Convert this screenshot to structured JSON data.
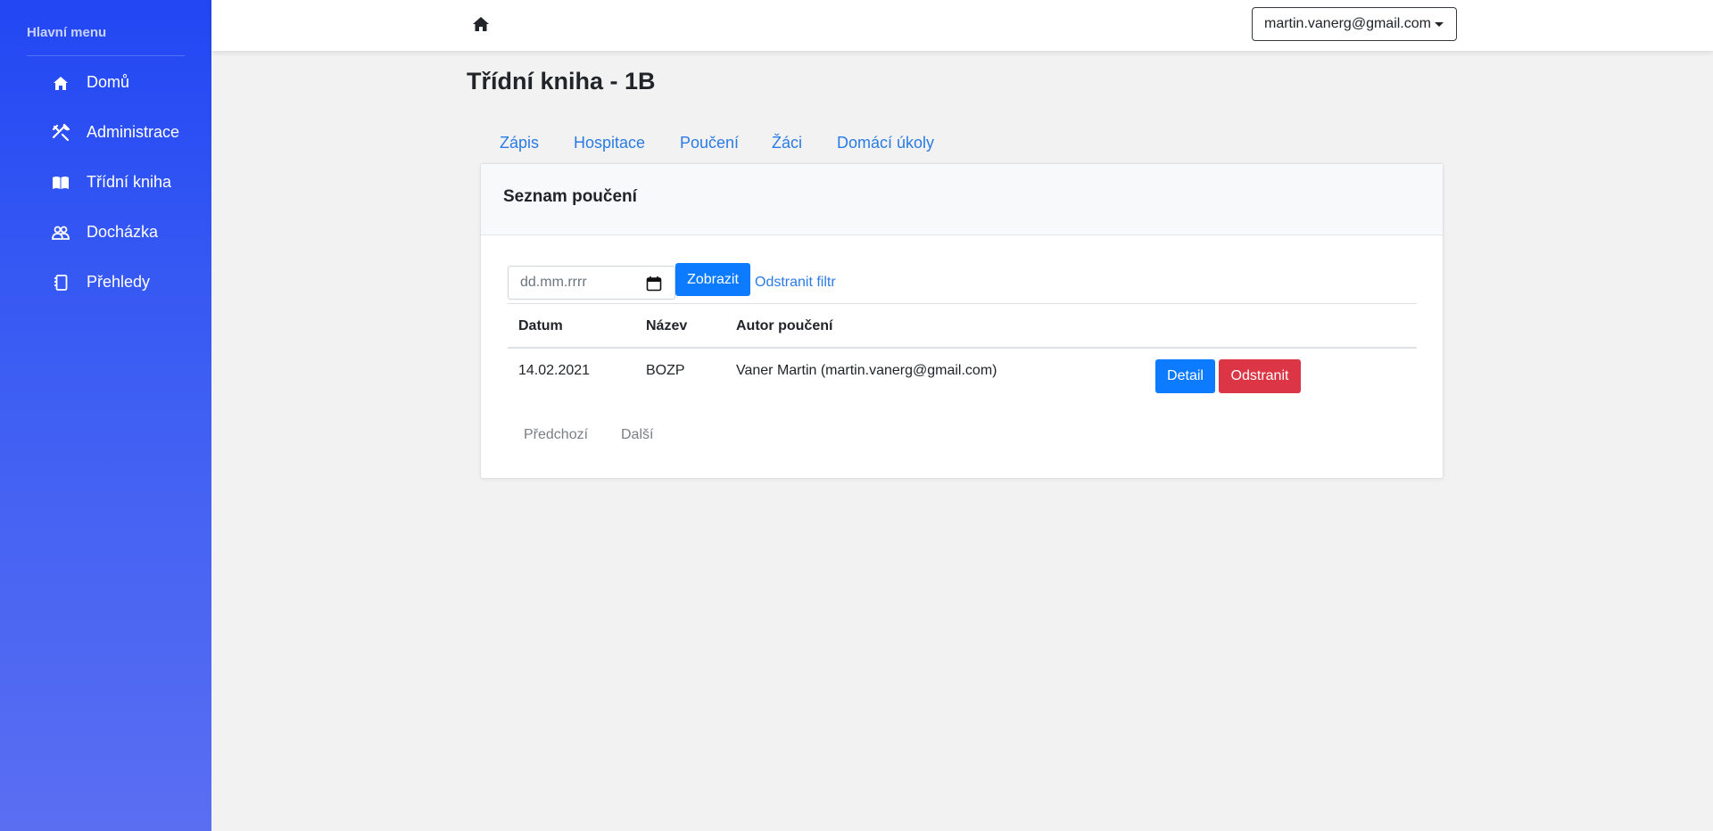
{
  "sidebar": {
    "heading": "Hlavní menu",
    "items": [
      {
        "label": "Domů",
        "icon": "home-icon"
      },
      {
        "label": "Administrace",
        "icon": "tools-icon"
      },
      {
        "label": "Třídní kniha",
        "icon": "book-icon"
      },
      {
        "label": "Docházka",
        "icon": "users-icon"
      },
      {
        "label": "Přehledy",
        "icon": "journal-icon"
      }
    ]
  },
  "topbar": {
    "home_icon": "home-icon",
    "user_email": "martin.vanerg@gmail.com"
  },
  "page": {
    "title": "Třídní kniha - 1B"
  },
  "tabs": [
    {
      "label": "Zápis"
    },
    {
      "label": "Hospitace"
    },
    {
      "label": "Poučení"
    },
    {
      "label": "Žáci"
    },
    {
      "label": "Domácí úkoly"
    }
  ],
  "card": {
    "title": "Seznam poučení",
    "filter": {
      "date_placeholder": "dd.mm.rrrr",
      "show_label": "Zobrazit",
      "clear_label": "Odstranit filtr"
    },
    "table": {
      "columns": [
        "Datum",
        "Název",
        "Autor poučení"
      ],
      "rows": [
        {
          "date": "14.02.2021",
          "name": "BOZP",
          "author": "Vaner Martin (martin.vanerg@gmail.com)",
          "detail_label": "Detail",
          "delete_label": "Odstranit"
        }
      ]
    },
    "pagination": {
      "prev_label": "Předchozí",
      "next_label": "Další"
    }
  },
  "colors": {
    "sidebar_top": "#2247f3",
    "sidebar_bottom": "#5a6ef2",
    "primary": "#0d7bff",
    "danger": "#dc3545",
    "link": "#2a7be4"
  }
}
